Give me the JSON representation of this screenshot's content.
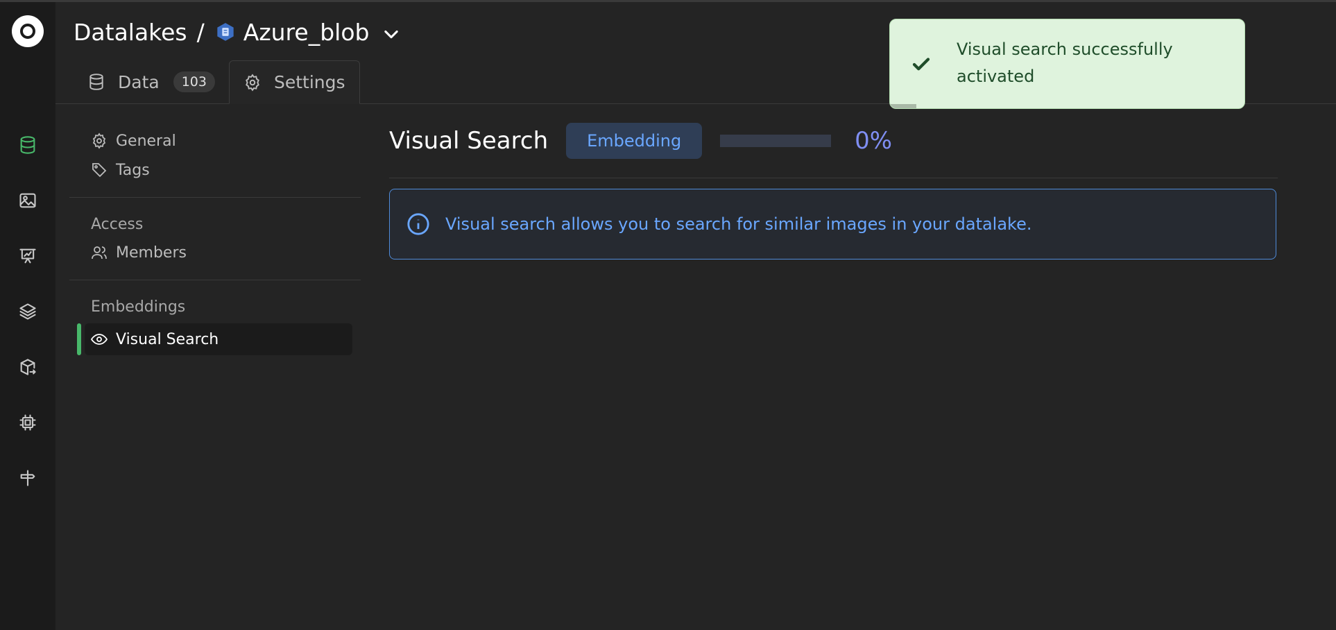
{
  "header": {
    "root_crumb": "Datalakes",
    "separator": "/",
    "datalake_name": "Azure_blob"
  },
  "tabs": [
    {
      "label": "Data",
      "count": "103"
    },
    {
      "label": "Settings"
    }
  ],
  "sidebar": {
    "general": "General",
    "tags": "Tags",
    "access_heading": "Access",
    "members": "Members",
    "embeddings_heading": "Embeddings",
    "visual_search": "Visual Search"
  },
  "main": {
    "title": "Visual Search",
    "status_badge": "Embedding",
    "progress_percent": 0,
    "progress_text": "0%",
    "info_text": "Visual search allows you to search for similar images in your datalake."
  },
  "toast": {
    "message": "Visual search successfully activated"
  },
  "colors": {
    "accent_green": "#48b86a",
    "info_blue": "#6aa7ff",
    "toast_bg": "#dff3dd"
  },
  "icons": {
    "rail": [
      "database-icon",
      "image-icon",
      "presentation-icon",
      "layers-icon",
      "box-export-icon",
      "cpu-icon",
      "signpost-icon"
    ]
  }
}
